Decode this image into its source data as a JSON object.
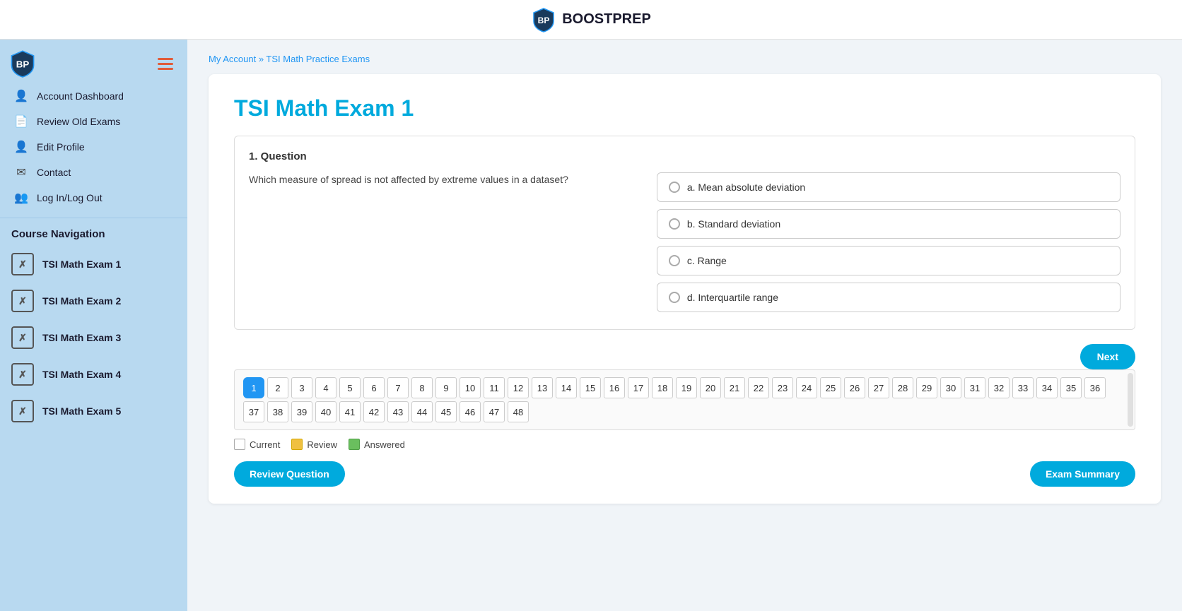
{
  "header": {
    "logo_text": "BOOSTPREP"
  },
  "sidebar": {
    "hamburger_label": "Menu",
    "menu_items": [
      {
        "id": "account-dashboard",
        "label": "Account Dashboard",
        "icon": "👤"
      },
      {
        "id": "review-old-exams",
        "label": "Review Old Exams",
        "icon": "📄"
      },
      {
        "id": "edit-profile",
        "label": "Edit Profile",
        "icon": "👤"
      },
      {
        "id": "contact",
        "label": "Contact",
        "icon": "✉"
      },
      {
        "id": "login-logout",
        "label": "Log In/Log Out",
        "icon": "👥"
      }
    ],
    "course_nav_label": "Course Navigation",
    "nav_items": [
      {
        "id": "exam1",
        "label": "TSI Math Exam 1",
        "icon": "✗"
      },
      {
        "id": "exam2",
        "label": "TSI Math Exam 2",
        "icon": "✗"
      },
      {
        "id": "exam3",
        "label": "TSI Math Exam 3",
        "icon": "✗"
      },
      {
        "id": "exam4",
        "label": "TSI Math Exam 4",
        "icon": "✗"
      },
      {
        "id": "exam5",
        "label": "TSI Math Exam 5",
        "icon": "✗"
      }
    ]
  },
  "breadcrumb": {
    "my_account": "My Account",
    "separator": " » ",
    "current": "TSI Math Practice Exams"
  },
  "exam": {
    "title": "TSI Math Exam 1",
    "question_label": "1. Question",
    "question_text": "Which measure of spread is not affected by extreme values in a dataset?",
    "options": [
      {
        "id": "a",
        "label": "a. Mean absolute deviation"
      },
      {
        "id": "b",
        "label": "b. Standard deviation"
      },
      {
        "id": "c",
        "label": "c. Range"
      },
      {
        "id": "d",
        "label": "d. Interquartile range"
      }
    ],
    "next_button": "Next",
    "question_numbers": [
      1,
      2,
      3,
      4,
      5,
      6,
      7,
      8,
      9,
      10,
      11,
      12,
      13,
      14,
      15,
      16,
      17,
      18,
      19,
      20,
      21,
      22,
      23,
      24,
      25,
      26,
      27,
      28,
      29,
      30,
      31,
      32,
      33,
      34,
      35,
      36,
      37,
      38,
      39,
      40,
      41,
      42,
      43,
      44,
      45,
      46,
      47,
      48
    ],
    "legend": {
      "current_label": "Current",
      "review_label": "Review",
      "answered_label": "Answered"
    },
    "review_question_btn": "Review Question",
    "exam_summary_btn": "Exam Summary"
  }
}
